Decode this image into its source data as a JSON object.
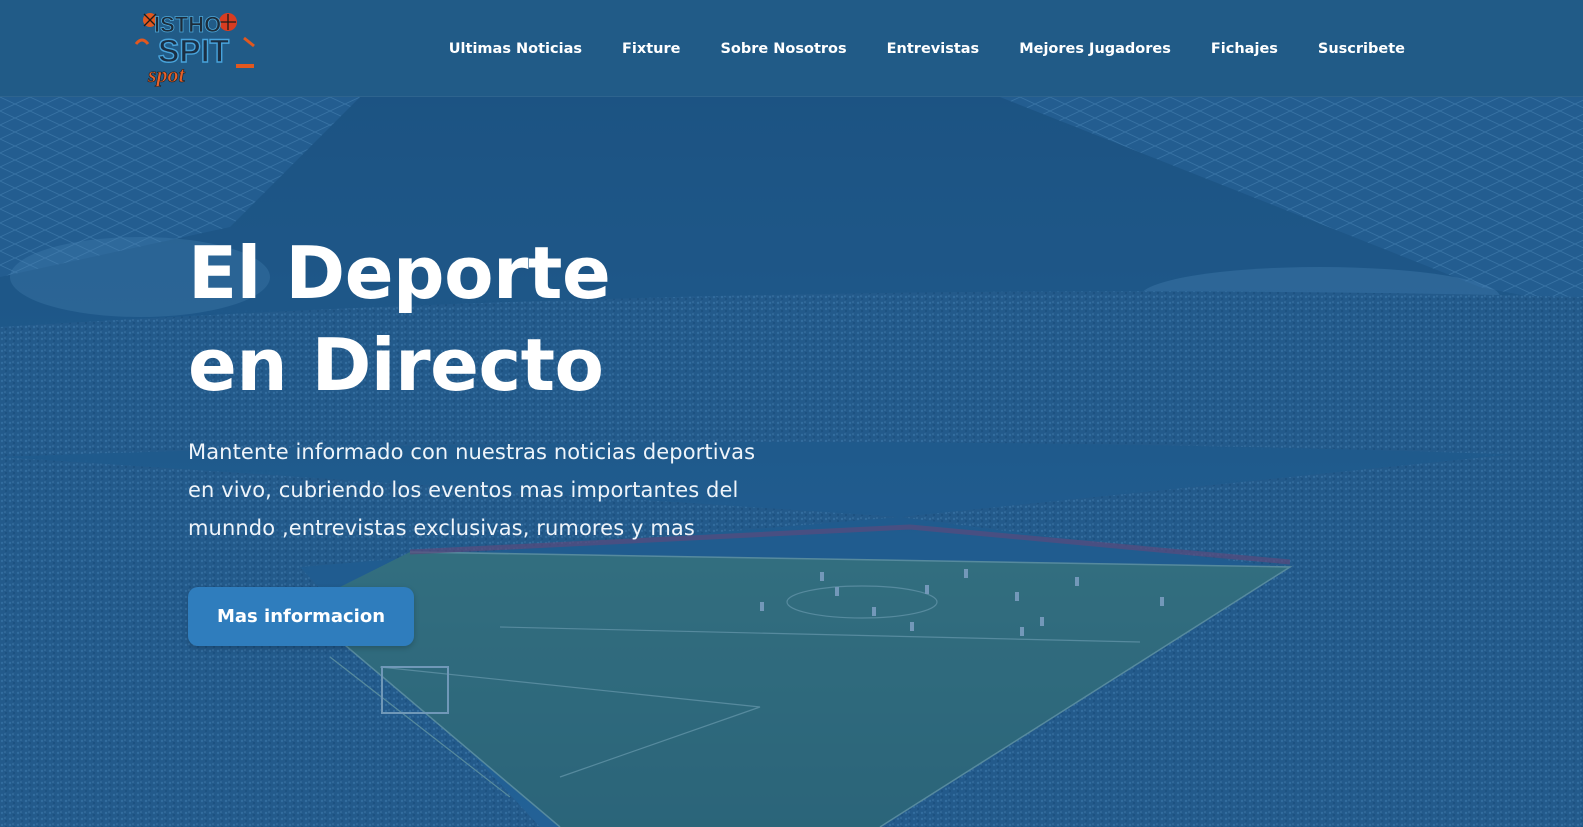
{
  "header": {
    "logo_text": "ISTHO SPIT SPOT",
    "nav": [
      {
        "label": "Ultimas Noticias"
      },
      {
        "label": "Fixture"
      },
      {
        "label": "Sobre Nosotros"
      },
      {
        "label": "Entrevistas"
      },
      {
        "label": "Mejores Jugadores"
      },
      {
        "label": "Fichajes"
      },
      {
        "label": "Suscribete"
      }
    ]
  },
  "hero": {
    "title_line1": "El Deporte",
    "title_line2": "en Directo",
    "subtitle": "Mantente informado con nuestras noticias deportivas en vivo, cubriendo los eventos mas importantes del munndo ,entrevistas exclusivas, rumores y mas",
    "cta_label": "Mas informacion",
    "background_image": "stadium-photo"
  },
  "colors": {
    "header_bg": "#215b87",
    "overlay": "#1e588c",
    "cta_bg": "#2f7dbd",
    "text": "#ffffff"
  }
}
